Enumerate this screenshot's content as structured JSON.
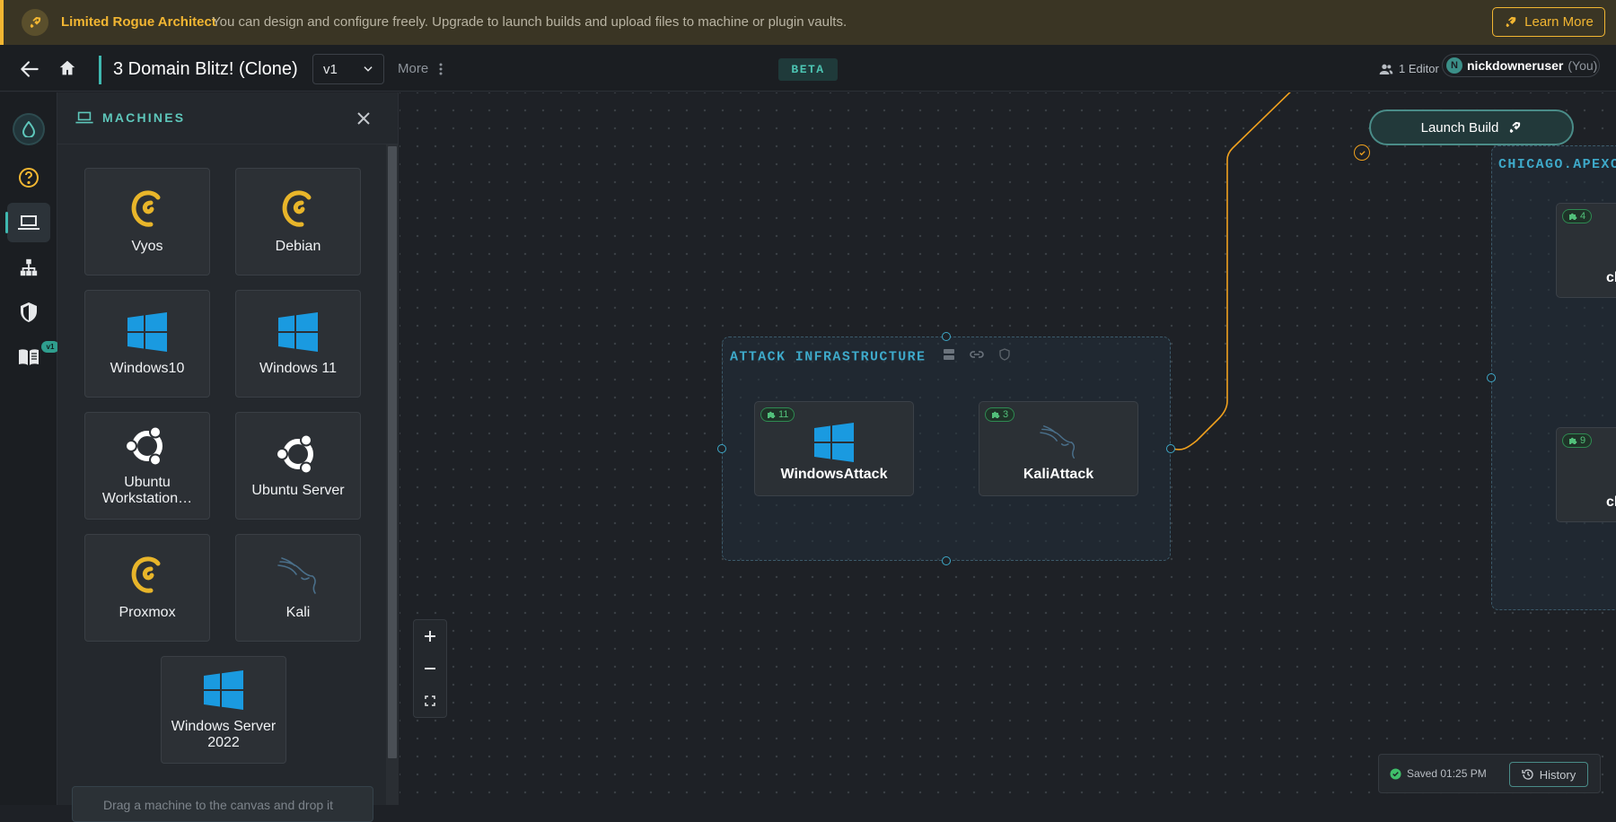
{
  "banner": {
    "title": "Limited Rogue Architect",
    "message": "You can design and configure freely. Upgrade to launch builds and upload files to machine or plugin vaults.",
    "learn_more": "Learn More"
  },
  "topbar": {
    "project_title": "3 Domain Blitz! (Clone)",
    "version": "v1",
    "more": "More",
    "beta": "BETA",
    "editors": "1 Editor",
    "user_initial": "N",
    "user_name": "nickdowneruser",
    "user_you": "(You)"
  },
  "rail": {
    "badge": "v1"
  },
  "machines_panel": {
    "title": "MACHINES",
    "items": [
      {
        "label": "Vyos",
        "icon": "debian-swirl-icon"
      },
      {
        "label": "Debian",
        "icon": "debian-swirl-icon"
      },
      {
        "label": "Windows10",
        "icon": "windows-icon"
      },
      {
        "label": "Windows 11",
        "icon": "windows-icon"
      },
      {
        "label": "Ubuntu Workstation…",
        "icon": "ubuntu-icon"
      },
      {
        "label": "Ubuntu Server",
        "icon": "ubuntu-icon"
      },
      {
        "label": "Proxmox",
        "icon": "debian-swirl-icon"
      },
      {
        "label": "Kali",
        "icon": "kali-dragon-icon"
      },
      {
        "label": "Windows Server 2022",
        "icon": "windows-icon"
      }
    ],
    "drag_hint": "Drag a machine to the canvas and drop it"
  },
  "canvas": {
    "launch_build": "Launch Build",
    "attack_group": {
      "title": "ATTACK INFRASTRUCTURE",
      "nodes": [
        {
          "label": "WindowsAttack",
          "plugins": "11",
          "icon": "windows-icon"
        },
        {
          "label": "KaliAttack",
          "plugins": "3",
          "icon": "kali-dragon-icon"
        }
      ]
    },
    "chicago_group": {
      "title": "CHICAGO.APEXC",
      "nodes": [
        {
          "label": "ch",
          "plugins": "4"
        },
        {
          "label": "ch",
          "plugins": "9"
        }
      ]
    },
    "save_status": "Saved 01:25 PM",
    "history": "History"
  },
  "colors": {
    "accent": "#3fb8b0",
    "banner": "#f2b632",
    "windows_blue": "#1a9ae0",
    "debian_gold": "#e8b52a",
    "connection": "#f0a11e"
  }
}
